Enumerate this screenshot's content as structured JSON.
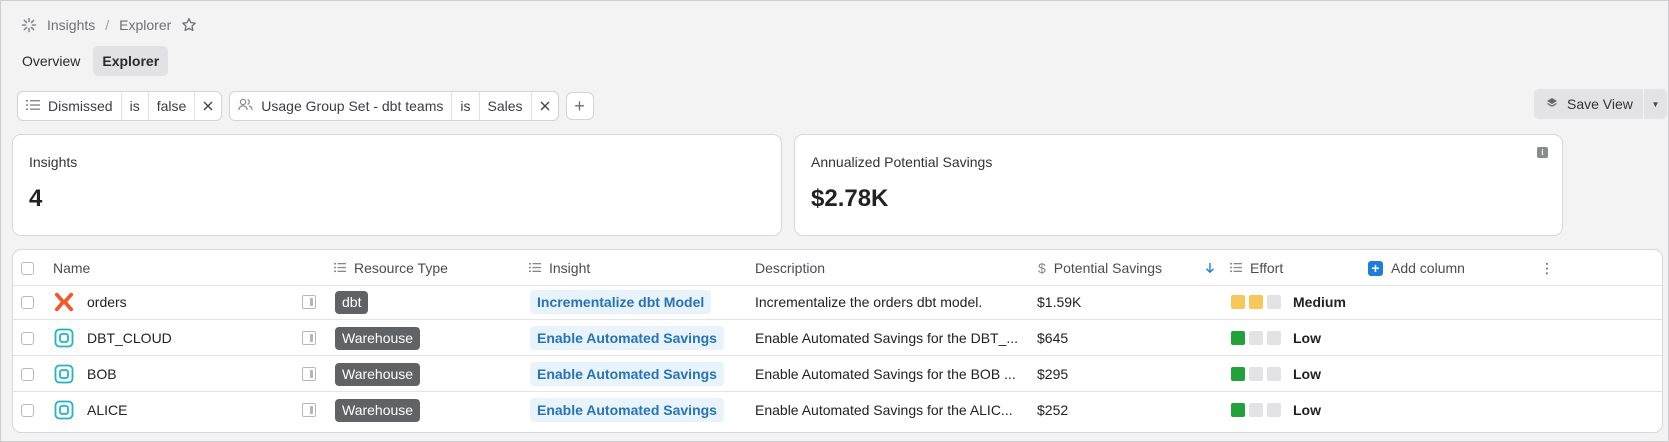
{
  "breadcrumb": {
    "root": "Insights",
    "separator": "/",
    "current": "Explorer"
  },
  "tabs": [
    {
      "label": "Overview"
    },
    {
      "label": "Explorer"
    }
  ],
  "filters": [
    {
      "field": "Dismissed",
      "op": "is",
      "value": "false",
      "icon": "list-icon"
    },
    {
      "field": "Usage Group Set - dbt teams",
      "op": "is",
      "value": "Sales",
      "icon": "users-icon"
    }
  ],
  "add_filter": "+",
  "save_view": {
    "label": "Save View"
  },
  "cards": {
    "insights": {
      "label": "Insights",
      "value": "4"
    },
    "savings": {
      "label": "Annualized Potential Savings",
      "value": "$2.78K"
    }
  },
  "table": {
    "headers": {
      "name": "Name",
      "resource_type": "Resource Type",
      "insight": "Insight",
      "description": "Description",
      "savings": "Potential Savings",
      "effort": "Effort",
      "add_column": "Add column"
    },
    "rows": [
      {
        "name": "orders",
        "icon": "dbt-icon",
        "resource": "dbt",
        "insight": "Incrementalize dbt Model",
        "description": "Incrementalize the orders dbt model.",
        "savings": "$1.59K",
        "effort_level": 2,
        "effort": "Medium"
      },
      {
        "name": "DBT_CLOUD",
        "icon": "warehouse-icon",
        "resource": "Warehouse",
        "insight": "Enable Automated Savings",
        "description": "Enable Automated Savings for the DBT_...",
        "savings": "$645",
        "effort_level": 1,
        "effort": "Low"
      },
      {
        "name": "BOB",
        "icon": "warehouse-icon",
        "resource": "Warehouse",
        "insight": "Enable Automated Savings",
        "description": "Enable Automated Savings for the BOB ...",
        "savings": "$295",
        "effort_level": 1,
        "effort": "Low"
      },
      {
        "name": "ALICE",
        "icon": "warehouse-icon",
        "resource": "Warehouse",
        "insight": "Enable Automated Savings",
        "description": "Enable Automated Savings for the ALIC...",
        "savings": "$252",
        "effort_level": 1,
        "effort": "Low"
      }
    ]
  },
  "colors": {
    "effort_medium": "#f7c75c",
    "effort_low": "#22a33a",
    "effort_empty": "#e3e3e6",
    "dbt_orange": "#ef5a2a",
    "warehouse_teal": "#1fb3c7",
    "accent": "#1e7fd8"
  }
}
